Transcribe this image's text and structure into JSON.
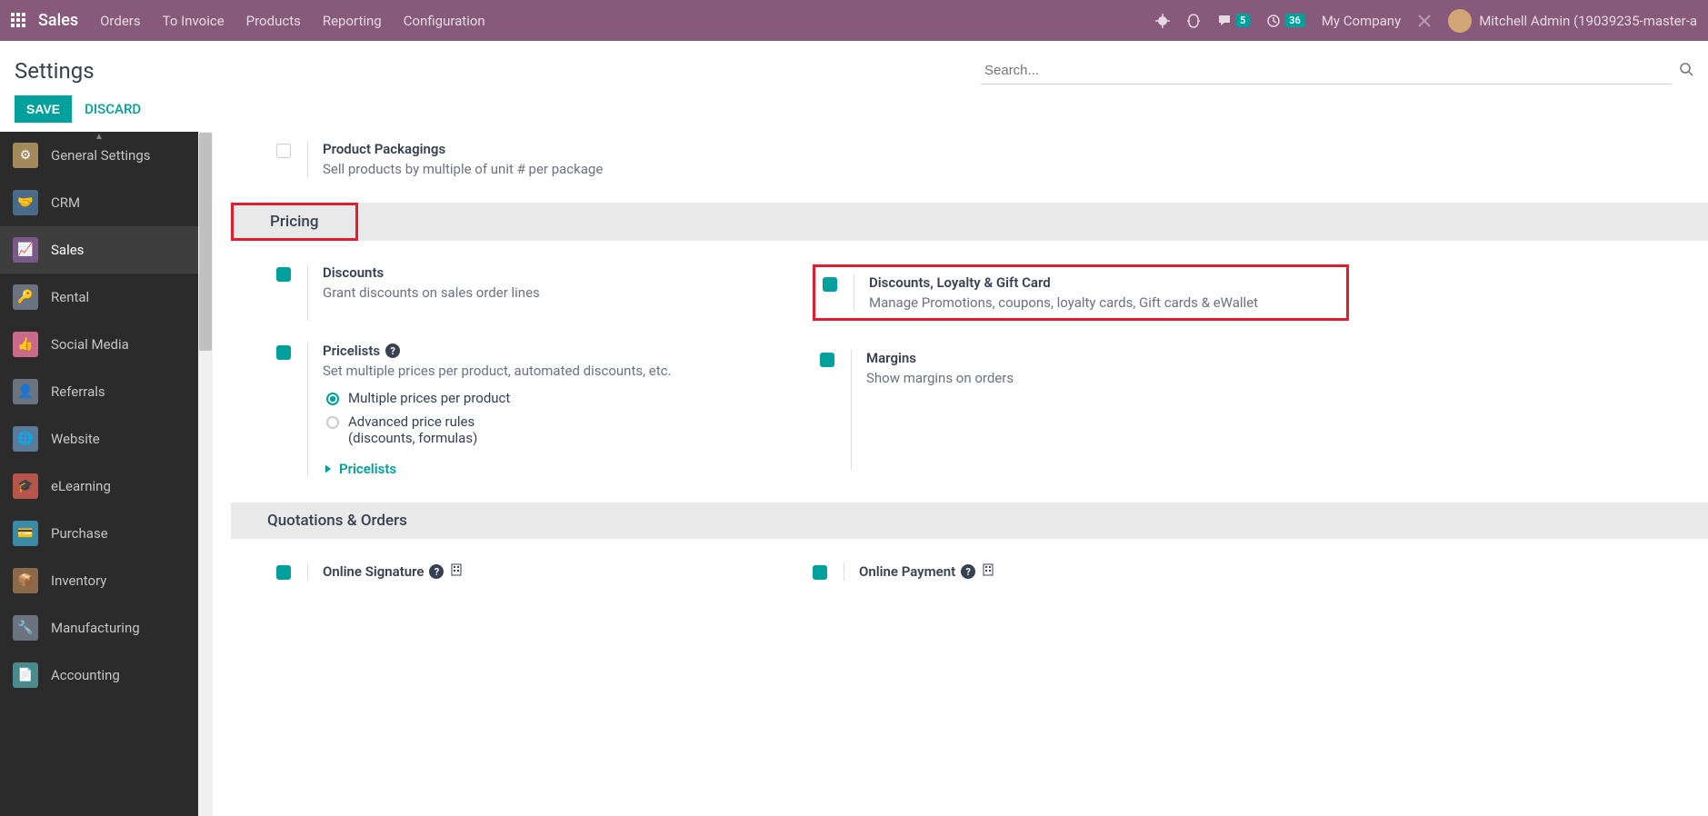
{
  "topbar": {
    "app_title": "Sales",
    "menu": [
      "Orders",
      "To Invoice",
      "Products",
      "Reporting",
      "Configuration"
    ],
    "messages_badge": "5",
    "activities_badge": "36",
    "company": "My Company",
    "user": "Mitchell Admin (19039235-master-a"
  },
  "header": {
    "title": "Settings",
    "search_placeholder": "Search..."
  },
  "actions": {
    "save": "SAVE",
    "discard": "DISCARD"
  },
  "sidebar": [
    {
      "label": "General Settings",
      "icon": "⚙",
      "bg": "#a28a5b"
    },
    {
      "label": "CRM",
      "icon": "🤝",
      "bg": "#4a6a8a"
    },
    {
      "label": "Sales",
      "icon": "📈",
      "bg": "#7b5a8a",
      "active": true
    },
    {
      "label": "Rental",
      "icon": "🔑",
      "bg": "#6b7280"
    },
    {
      "label": "Social Media",
      "icon": "👍",
      "bg": "#c96a8a"
    },
    {
      "label": "Referrals",
      "icon": "👤",
      "bg": "#6b7280"
    },
    {
      "label": "Website",
      "icon": "🌐",
      "bg": "#5a7a9a"
    },
    {
      "label": "eLearning",
      "icon": "🎓",
      "bg": "#b8554a"
    },
    {
      "label": "Purchase",
      "icon": "💳",
      "bg": "#3a8aa8"
    },
    {
      "label": "Inventory",
      "icon": "📦",
      "bg": "#8a6a4a"
    },
    {
      "label": "Manufacturing",
      "icon": "🔧",
      "bg": "#6b7280"
    },
    {
      "label": "Accounting",
      "icon": "📄",
      "bg": "#4a8a8a"
    }
  ],
  "settings": {
    "packagings": {
      "title": "Product Packagings",
      "desc": "Sell products by multiple of unit # per package"
    },
    "pricing_header": "Pricing",
    "discounts": {
      "title": "Discounts",
      "desc": "Grant discounts on sales order lines"
    },
    "loyalty": {
      "title": "Discounts, Loyalty & Gift Card",
      "desc": "Manage Promotions, coupons, loyalty cards, Gift cards & eWallet"
    },
    "pricelists": {
      "title": "Pricelists",
      "desc": "Set multiple prices per product, automated discounts, etc."
    },
    "margins": {
      "title": "Margins",
      "desc": "Show margins on orders"
    },
    "radio_multiple": "Multiple prices per product",
    "radio_advanced": "Advanced price rules",
    "radio_advanced2": "(discounts, formulas)",
    "pricelists_link": "Pricelists",
    "quotations_header": "Quotations & Orders",
    "online_sig": {
      "title": "Online Signature"
    },
    "online_pay": {
      "title": "Online Payment"
    }
  }
}
